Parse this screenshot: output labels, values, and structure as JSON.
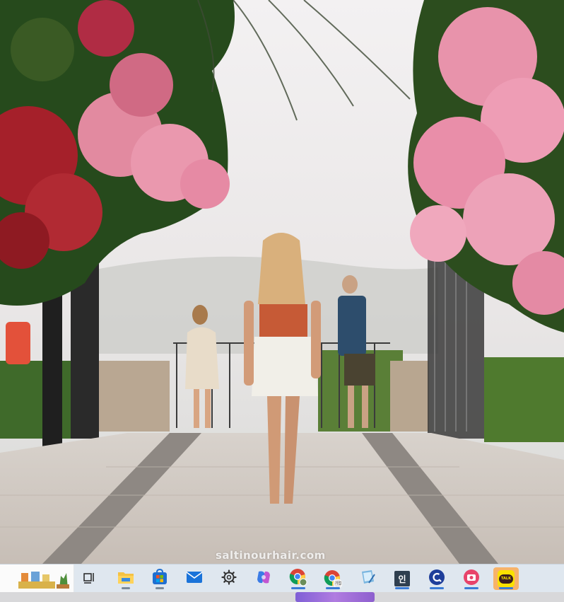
{
  "wallpaper": {
    "watermark_text": "saltinourhair.com",
    "scene": "photo"
  },
  "taskbar": {
    "widget": {
      "icon": "weather-news-widget-icon"
    },
    "items": [
      {
        "id": "task-view",
        "icon": "task-view-icon"
      },
      {
        "id": "file-explorer",
        "icon": "folder-icon"
      },
      {
        "id": "microsoft-store",
        "icon": "store-icon"
      },
      {
        "id": "mail",
        "icon": "mail-icon"
      },
      {
        "id": "settings",
        "icon": "gear-icon"
      },
      {
        "id": "copilot",
        "icon": "copilot-icon"
      },
      {
        "id": "chrome-profile-1",
        "icon": "chrome-icon"
      },
      {
        "id": "chrome-profile-2",
        "icon": "chrome-icon",
        "badge": "기업"
      },
      {
        "id": "notepad",
        "icon": "notepad-icon"
      },
      {
        "id": "korean-app",
        "icon": "korean-glyph-icon",
        "glyph": "인"
      },
      {
        "id": "search-app",
        "icon": "magnifier-c-icon"
      },
      {
        "id": "camera-app",
        "icon": "camera-icon"
      },
      {
        "id": "kakaotalk",
        "icon": "kakaotalk-icon",
        "label": "TALK"
      }
    ]
  },
  "colors": {
    "taskbar_bg": "#dfe7ef",
    "highlight": "#f7b36a",
    "kakao_yellow": "#fae100"
  }
}
